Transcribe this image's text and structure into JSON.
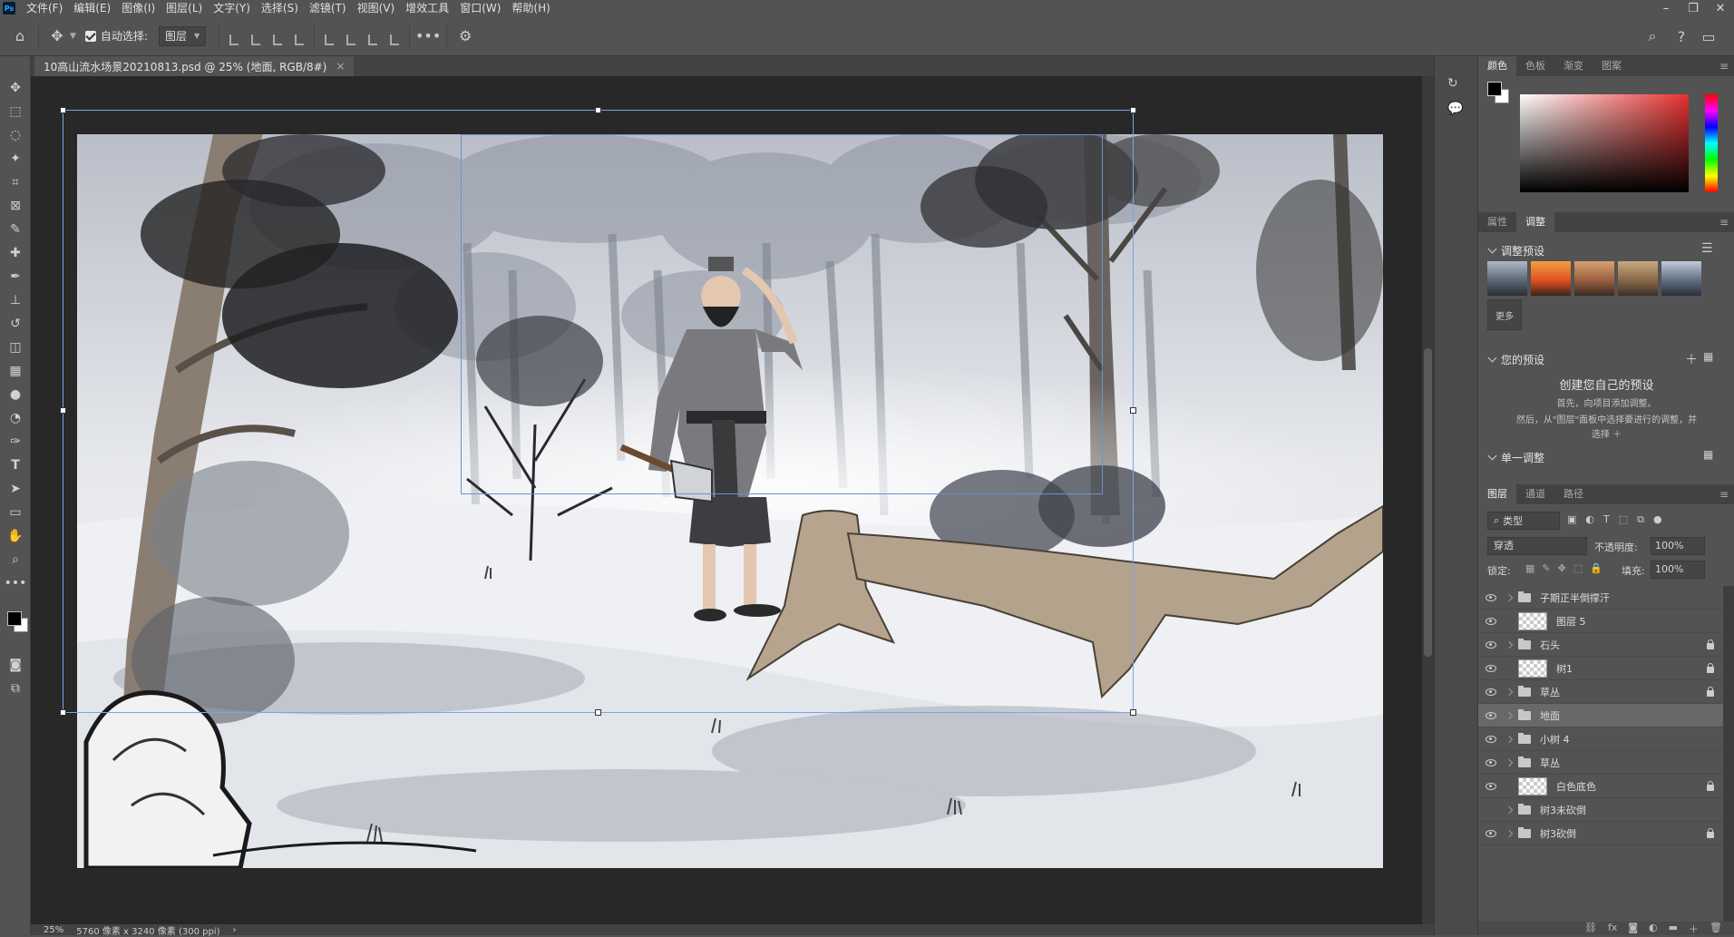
{
  "menu": [
    "文件(F)",
    "编辑(E)",
    "图像(I)",
    "图层(L)",
    "文字(Y)",
    "选择(S)",
    "滤镜(T)",
    "视图(V)",
    "增效工具",
    "窗口(W)",
    "帮助(H)"
  ],
  "options": {
    "auto_select_label": "自动选择:",
    "auto_select_target": "图层"
  },
  "document": {
    "tab_title": "10高山流水场景20210813.psd @ 25% (地面, RGB/8#)",
    "close_glyph": "×"
  },
  "status": {
    "zoom": "25%",
    "doc_size": "5760 像素 x 3240 像素 (300 ppi)"
  },
  "color_panel": {
    "tabs": [
      "颜色",
      "色板",
      "渐变",
      "图案"
    ],
    "foreground": "#000000",
    "background": "#ffffff",
    "hue_color": "#e63030"
  },
  "adjust_panel": {
    "tabs": [
      "属性",
      "调整"
    ],
    "presets_title": "调整预设",
    "more_label": "更多",
    "your_presets_title": "您的预设",
    "create_title": "创建您自己的预设",
    "create_line1": "首先，向项目添加调整。",
    "create_line2": "然后，从\"图层\"面板中选择要进行的调整，并",
    "create_line3": "选择 ＋",
    "single_title": "单一调整"
  },
  "layers_panel": {
    "tabs": [
      "图层",
      "通道",
      "路径"
    ],
    "filter_label": "类型",
    "blend_mode": "穿透",
    "opacity_label": "不透明度:",
    "opacity_value": "100%",
    "lock_label": "锁定:",
    "fill_label": "填充:",
    "fill_value": "100%",
    "layers": [
      {
        "name": "子期正半倒撑汗",
        "kind": "group",
        "visible": true,
        "locked": false,
        "selected": false
      },
      {
        "name": "图层 5",
        "kind": "layer",
        "visible": true,
        "locked": false,
        "selected": false
      },
      {
        "name": "石头",
        "kind": "group",
        "visible": true,
        "locked": true,
        "selected": false
      },
      {
        "name": "树1",
        "kind": "layer",
        "visible": true,
        "locked": true,
        "selected": false
      },
      {
        "name": "草丛",
        "kind": "group",
        "visible": true,
        "locked": true,
        "selected": false
      },
      {
        "name": "地面",
        "kind": "group",
        "visible": true,
        "locked": false,
        "selected": true
      },
      {
        "name": "小树 4",
        "kind": "group",
        "visible": true,
        "locked": false,
        "selected": false
      },
      {
        "name": "草丛",
        "kind": "group",
        "visible": true,
        "locked": false,
        "selected": false
      },
      {
        "name": "白色底色",
        "kind": "layer",
        "visible": true,
        "locked": true,
        "selected": false
      },
      {
        "name": "树3未砍倒",
        "kind": "group",
        "visible": false,
        "locked": false,
        "selected": false
      },
      {
        "name": "树3砍倒",
        "kind": "group",
        "visible": true,
        "locked": true,
        "selected": false
      }
    ]
  }
}
